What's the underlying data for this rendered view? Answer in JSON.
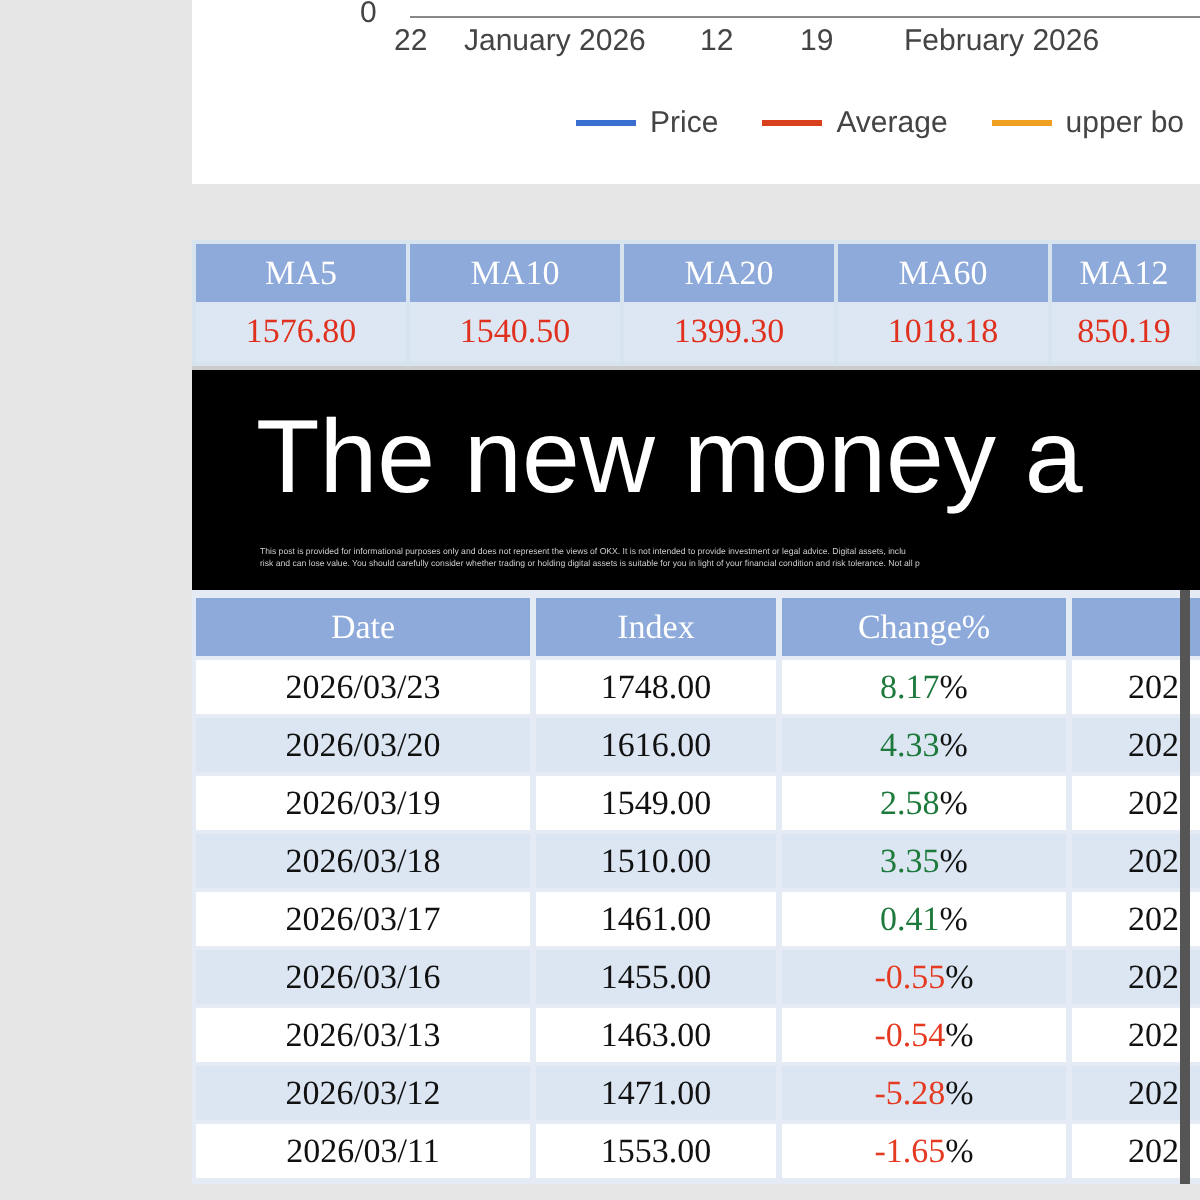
{
  "chart": {
    "y_tick": "0",
    "x_labels": [
      "22",
      "January 2026",
      "12",
      "19",
      "February 2026"
    ],
    "legend": [
      {
        "label": "Price",
        "color": "#3a6fd0"
      },
      {
        "label": "Average",
        "color": "#d9401e"
      },
      {
        "label": "upper bo",
        "color": "#f0a020"
      }
    ]
  },
  "ma_table": {
    "columns": [
      "MA5",
      "MA10",
      "MA20",
      "MA60",
      "MA12"
    ],
    "values": [
      "1576.80",
      "1540.50",
      "1399.30",
      "1018.18",
      "850.19"
    ]
  },
  "banner": {
    "headline": "The new money a",
    "disclaimer": [
      "This post is provided for informational purposes only and does not represent the views of OKX. It is not intended to provide investment or legal advice. Digital assets, inclu",
      "risk and can lose value. You should carefully consider whether trading or holding digital assets is suitable for you in light of your financial condition and risk tolerance. Not all p"
    ]
  },
  "table": {
    "columns": [
      "Date",
      "Index",
      "Change%",
      ""
    ],
    "rows": [
      {
        "date": "2026/03/23",
        "index": "1748.00",
        "change": "8.17",
        "suffix": "%",
        "color": "#1e7a3c",
        "column_4": "202"
      },
      {
        "date": "2026/03/20",
        "index": "1616.00",
        "change": "4.33",
        "suffix": "%",
        "color": "#1e7a3c",
        "column_4": "202"
      },
      {
        "date": "2026/03/19",
        "index": "1549.00",
        "change": "2.58",
        "suffix": "%",
        "color": "#1e7a3c",
        "column_4": "202"
      },
      {
        "date": "2026/03/18",
        "index": "1510.00",
        "change": "3.35",
        "suffix": "%",
        "color": "#1e7a3c",
        "column_4": "202"
      },
      {
        "date": "2026/03/17",
        "index": "1461.00",
        "change": "0.41",
        "suffix": "%",
        "color": "#1e7a3c",
        "column_4": "202"
      },
      {
        "date": "2026/03/16",
        "index": "1455.00",
        "change": "-0.55",
        "suffix": "%",
        "color": "#e53a22",
        "column_4": "202"
      },
      {
        "date": "2026/03/13",
        "index": "1463.00",
        "change": "-0.54",
        "suffix": "%",
        "color": "#e53a22",
        "column_4": "202"
      },
      {
        "date": "2026/03/12",
        "index": "1471.00",
        "change": "-5.28",
        "suffix": "%",
        "color": "#e53a22",
        "column_4": "202"
      },
      {
        "date": "2026/03/11",
        "index": "1553.00",
        "change": "-1.65",
        "suffix": "%",
        "color": "#e53a22",
        "column_4": "202"
      }
    ]
  }
}
